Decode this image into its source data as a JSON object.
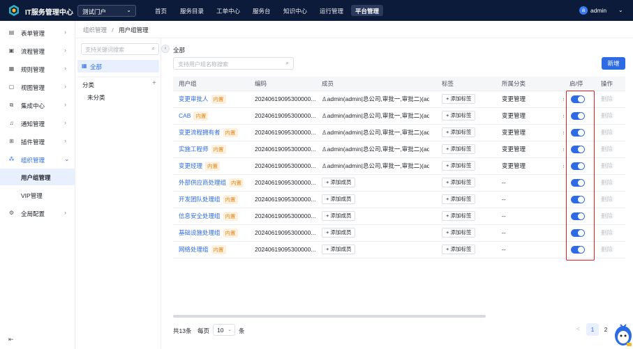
{
  "app": {
    "title": "IT服务管理中心",
    "portal": "测试门户"
  },
  "topnav": [
    {
      "label": "首页",
      "active": false
    },
    {
      "label": "服务目录",
      "active": false
    },
    {
      "label": "工单中心",
      "active": false
    },
    {
      "label": "服务台",
      "active": false
    },
    {
      "label": "知识中心",
      "active": false
    },
    {
      "label": "运行管理",
      "active": false
    },
    {
      "label": "平台管理",
      "active": true
    }
  ],
  "user": {
    "avatar_letter": "a",
    "name": "admin"
  },
  "sidebar": {
    "items": [
      {
        "label": "表单管理",
        "icon": "form-icon"
      },
      {
        "label": "流程管理",
        "icon": "flow-icon"
      },
      {
        "label": "规则管理",
        "icon": "rule-icon"
      },
      {
        "label": "视图管理",
        "icon": "view-icon"
      },
      {
        "label": "集成中心",
        "icon": "integration-icon"
      },
      {
        "label": "通知管理",
        "icon": "bell-icon"
      },
      {
        "label": "插件管理",
        "icon": "plugin-icon"
      },
      {
        "label": "组织管理",
        "icon": "org-icon",
        "active": true
      },
      {
        "label": "全局配置",
        "icon": "gear-icon"
      }
    ],
    "subitems": [
      {
        "label": "用户组管理",
        "active": true
      },
      {
        "label": "VIP管理",
        "active": false
      }
    ]
  },
  "breadcrumb": {
    "parent": "组织管理",
    "separator": "/",
    "current": "用户组管理"
  },
  "tree": {
    "search_placeholder": "支持关键词搜索",
    "all_label": "全部",
    "category_label": "分类",
    "uncategorized": "未分类"
  },
  "main": {
    "title": "全部",
    "search_placeholder": "支持用户组名称搜索",
    "add_button": "新增"
  },
  "table": {
    "headers": [
      "用户组",
      "编码",
      "成员",
      "标签",
      "所属分类",
      "",
      "启/停",
      "操作"
    ],
    "builtin_badge": "内置",
    "add_member": "添加成员",
    "add_tag": "添加标签",
    "delete": "删除",
    "rows": [
      {
        "name": "变更审批人",
        "code": "20240619095300000...",
        "members": "admin(admin|总公司,审批一,审批二)(admin|总公司,审批一,审批二)",
        "has_members": true,
        "category": "变更管理",
        "extra": "s",
        "enabled": true
      },
      {
        "name": "CAB",
        "code": "20240619095300000...",
        "members": "admin(admin|总公司,审批一,审批二)(admin|总公司,审批一,审批二)",
        "has_members": true,
        "category": "变更管理",
        "extra": "s",
        "enabled": true
      },
      {
        "name": "变更流程拥有者",
        "code": "20240619095300000...",
        "members": "admin(admin|总公司,审批一,审批二)(admin|总公司,审批一,审批二)",
        "has_members": true,
        "category": "变更管理",
        "extra": "s",
        "enabled": true
      },
      {
        "name": "实施工程师",
        "code": "20240619095300000...",
        "members": "admin(admin|总公司,审批一,审批二)(admin|总公司,审批一,审批二)",
        "has_members": true,
        "category": "变更管理",
        "extra": "s",
        "enabled": true
      },
      {
        "name": "变更经理",
        "code": "20240619095300000...",
        "members": "admin(admin|总公司,审批一,审批二)(admin|总公司,审批一,审批二)",
        "has_members": true,
        "category": "变更管理",
        "extra": "s",
        "enabled": true
      },
      {
        "name": "外部供应商处理组",
        "code": "20240619095300000...",
        "members": "",
        "has_members": false,
        "category": "--",
        "extra": "",
        "enabled": true
      },
      {
        "name": "开发团队处理组",
        "code": "20240619095300000...",
        "members": "",
        "has_members": false,
        "category": "--",
        "extra": "",
        "enabled": true
      },
      {
        "name": "信息安全处理组",
        "code": "20240619095300000...",
        "members": "",
        "has_members": false,
        "category": "--",
        "extra": "",
        "enabled": true
      },
      {
        "name": "基础设施处理组",
        "code": "20240619095300000...",
        "members": "",
        "has_members": false,
        "category": "--",
        "extra": "",
        "enabled": true
      },
      {
        "name": "网络处理组",
        "code": "20240619095300000...",
        "members": "",
        "has_members": false,
        "category": "--",
        "extra": "",
        "enabled": true
      }
    ]
  },
  "pagination": {
    "total": "共13条",
    "per_page_label": "每页",
    "per_page": "10",
    "per_page_unit": "条",
    "pages": [
      "1",
      "2"
    ],
    "current": "1",
    "prev": "<"
  },
  "colors": {
    "primary": "#2d6be4",
    "topbar": "#0d1b3a",
    "highlight_box": "#e02020"
  }
}
